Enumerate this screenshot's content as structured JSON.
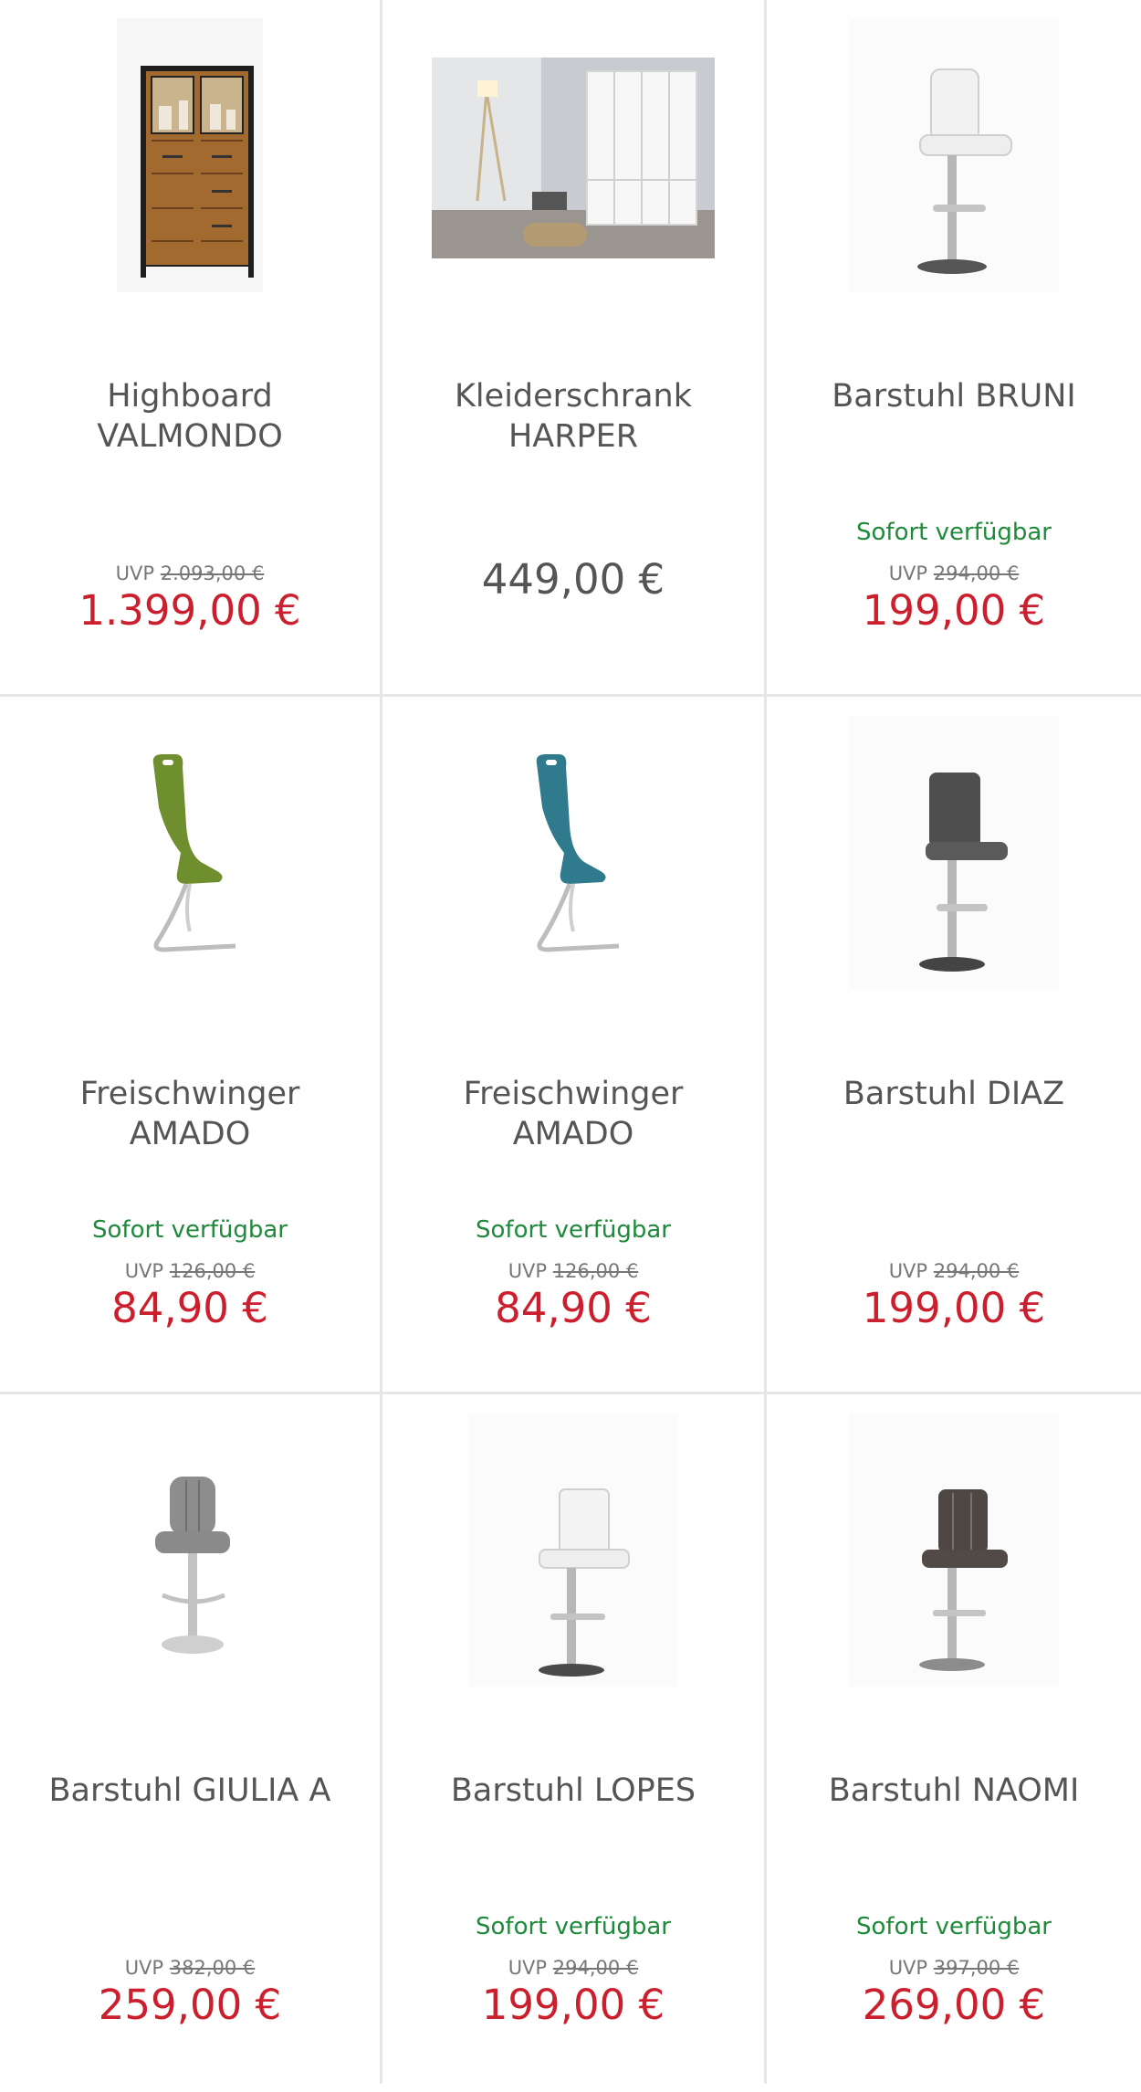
{
  "colors": {
    "price_sale": "#cc1f2e",
    "price_regular": "#555555",
    "availability": "#1e8a3a",
    "divider": "#e6e6e6"
  },
  "products": [
    {
      "name": "Highboard VALMONDO",
      "image_icon": "highboard-icon",
      "availability": "",
      "uvp_label": "UVP",
      "uvp_price": "2.093,00 €",
      "price": "1.399,00 €"
    },
    {
      "name": "Kleiderschrank HARPER",
      "image_icon": "wardrobe-room-icon",
      "availability": "",
      "uvp_label": "",
      "uvp_price": "",
      "price": "449,00 €"
    },
    {
      "name": "Barstuhl BRUNI",
      "image_icon": "barstool-white-icon",
      "availability": "Sofort verfügbar",
      "uvp_label": "UVP",
      "uvp_price": "294,00 €",
      "price": "199,00 €"
    },
    {
      "name": "Freischwinger AMADO",
      "image_icon": "cantilever-chair-green-icon",
      "availability": "Sofort verfügbar",
      "uvp_label": "UVP",
      "uvp_price": "126,00 €",
      "price": "84,90 €"
    },
    {
      "name": "Freischwinger AMADO",
      "image_icon": "cantilever-chair-petrol-icon",
      "availability": "Sofort verfügbar",
      "uvp_label": "UVP",
      "uvp_price": "126,00 €",
      "price": "84,90 €"
    },
    {
      "name": "Barstuhl DIAZ",
      "image_icon": "barstool-anthracite-icon",
      "availability": "",
      "uvp_label": "UVP",
      "uvp_price": "294,00 €",
      "price": "199,00 €"
    },
    {
      "name": "Barstuhl GIULIA A",
      "image_icon": "barstool-grey-icon",
      "availability": "",
      "uvp_label": "UVP",
      "uvp_price": "382,00 €",
      "price": "259,00 €"
    },
    {
      "name": "Barstuhl LOPES",
      "image_icon": "barstool-white-icon",
      "availability": "Sofort verfügbar",
      "uvp_label": "UVP",
      "uvp_price": "294,00 €",
      "price": "199,00 €"
    },
    {
      "name": "Barstuhl NAOMI",
      "image_icon": "barstool-brown-icon",
      "availability": "Sofort verfügbar",
      "uvp_label": "UVP",
      "uvp_price": "397,00 €",
      "price": "269,00 €"
    }
  ]
}
